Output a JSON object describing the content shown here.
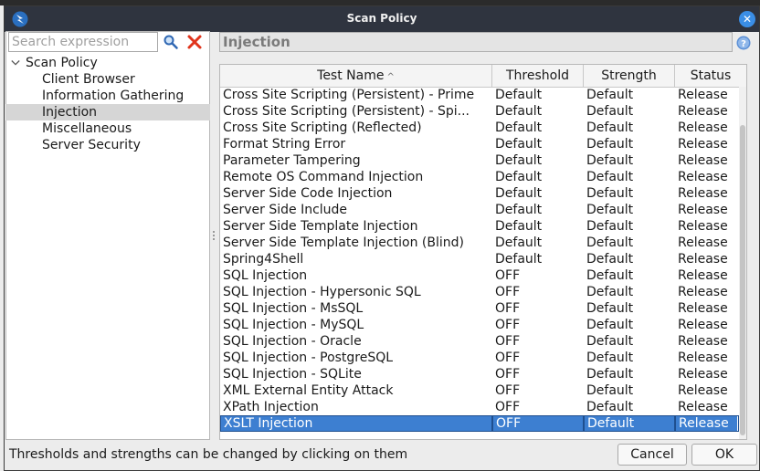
{
  "window": {
    "title": "Scan Policy",
    "close_glyph": "✕"
  },
  "search": {
    "placeholder": "Search expression",
    "value": ""
  },
  "tree": {
    "root": "Scan Policy",
    "children": [
      "Client Browser",
      "Information Gathering",
      "Injection",
      "Miscellaneous",
      "Server Security"
    ],
    "selected": "Injection"
  },
  "panel": {
    "header": "Injection"
  },
  "table": {
    "columns": [
      "Test Name",
      "Threshold",
      "Strength",
      "Status"
    ],
    "sort_indicator": "^",
    "rows": [
      [
        "Cross Site Scripting (Persistent) - Prime",
        "Default",
        "Default",
        "Release"
      ],
      [
        "Cross Site Scripting (Persistent) - Spi...",
        "Default",
        "Default",
        "Release"
      ],
      [
        "Cross Site Scripting (Reflected)",
        "Default",
        "Default",
        "Release"
      ],
      [
        "Format String Error",
        "Default",
        "Default",
        "Release"
      ],
      [
        "Parameter Tampering",
        "Default",
        "Default",
        "Release"
      ],
      [
        "Remote OS Command Injection",
        "Default",
        "Default",
        "Release"
      ],
      [
        "Server Side Code Injection",
        "Default",
        "Default",
        "Release"
      ],
      [
        "Server Side Include",
        "Default",
        "Default",
        "Release"
      ],
      [
        "Server Side Template Injection",
        "Default",
        "Default",
        "Release"
      ],
      [
        "Server Side Template Injection (Blind)",
        "Default",
        "Default",
        "Release"
      ],
      [
        "Spring4Shell",
        "Default",
        "Default",
        "Release"
      ],
      [
        "SQL Injection",
        "OFF",
        "Default",
        "Release"
      ],
      [
        "SQL Injection - Hypersonic SQL",
        "OFF",
        "Default",
        "Release"
      ],
      [
        "SQL Injection - MsSQL",
        "OFF",
        "Default",
        "Release"
      ],
      [
        "SQL Injection - MySQL",
        "OFF",
        "Default",
        "Release"
      ],
      [
        "SQL Injection - Oracle",
        "OFF",
        "Default",
        "Release"
      ],
      [
        "SQL Injection - PostgreSQL",
        "OFF",
        "Default",
        "Release"
      ],
      [
        "SQL Injection - SQLite",
        "OFF",
        "Default",
        "Release"
      ],
      [
        "XML External Entity Attack",
        "OFF",
        "Default",
        "Release"
      ],
      [
        "XPath Injection",
        "OFF",
        "Default",
        "Release"
      ],
      [
        "XSLT Injection",
        "OFF",
        "Default",
        "Release"
      ]
    ],
    "selected_row": "XSLT Injection"
  },
  "footer": {
    "hint": "Thresholds and strengths can be changed by clicking on them",
    "cancel_label": "Cancel",
    "ok_label": "OK"
  },
  "icons": {
    "app": "zap-logo-icon",
    "close": "close-icon",
    "search": "search-icon",
    "clear": "clear-icon",
    "help": "help-icon"
  },
  "colors": {
    "titlebar": "#2f343f",
    "selection": "#3d7fd1",
    "close_button": "#3a8ee6",
    "clear_icon": "#e0341c"
  }
}
